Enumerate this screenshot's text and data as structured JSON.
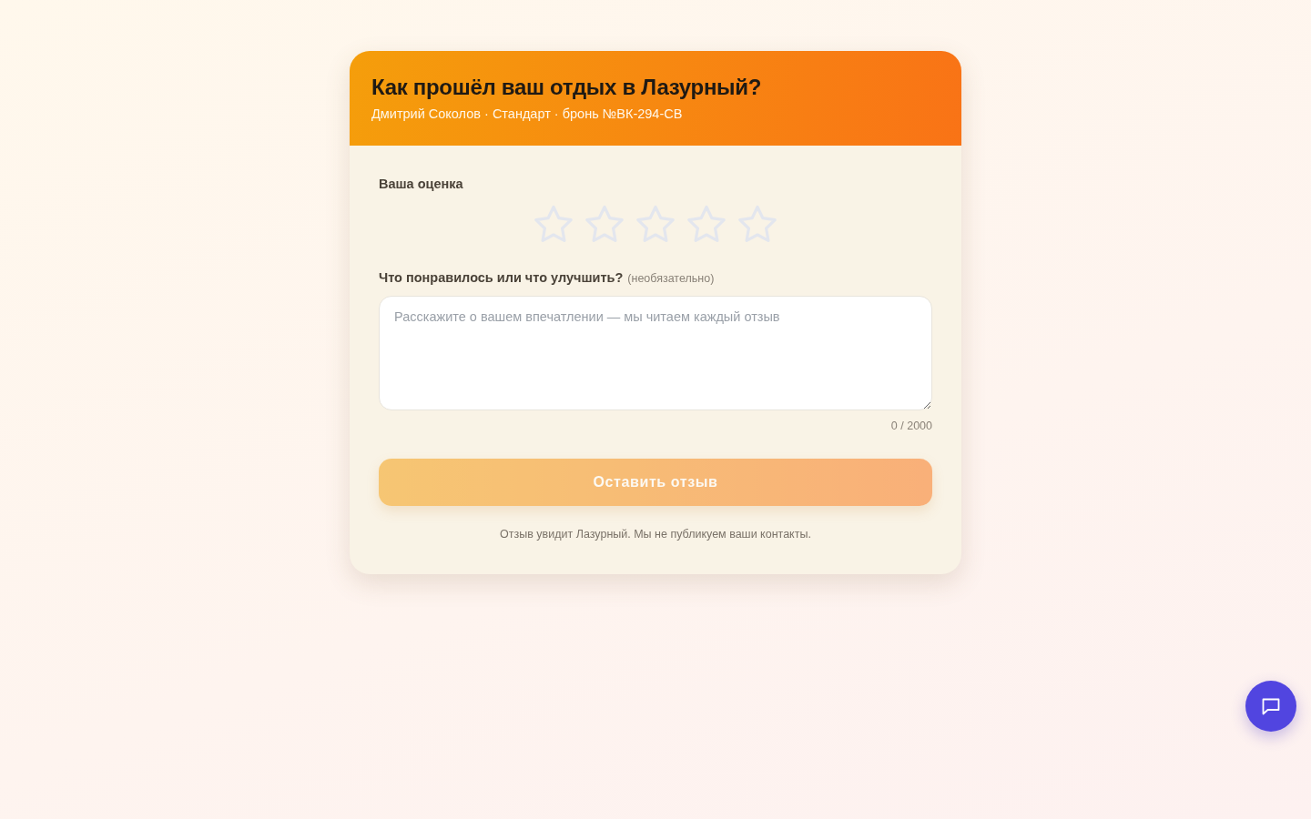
{
  "header": {
    "title": "Как прошёл ваш отдых в Лазурный?",
    "subtitle": "Дмитрий Соколов · Стандарт · бронь №ВК-294-СВ"
  },
  "rating": {
    "label": "Ваша оценка",
    "stars": 0
  },
  "comment": {
    "label": "Что понравилось или что улучшить?",
    "hint": "(необязательно)",
    "placeholder": "Расскажите о вашем впечатлении — мы читаем каждый отзыв",
    "counter": "0 / 2000"
  },
  "submit": {
    "label": "Оставить отзыв",
    "disabled": true
  },
  "note": "Отзыв увидит Лазурный. Мы не публикуем ваши контакты."
}
